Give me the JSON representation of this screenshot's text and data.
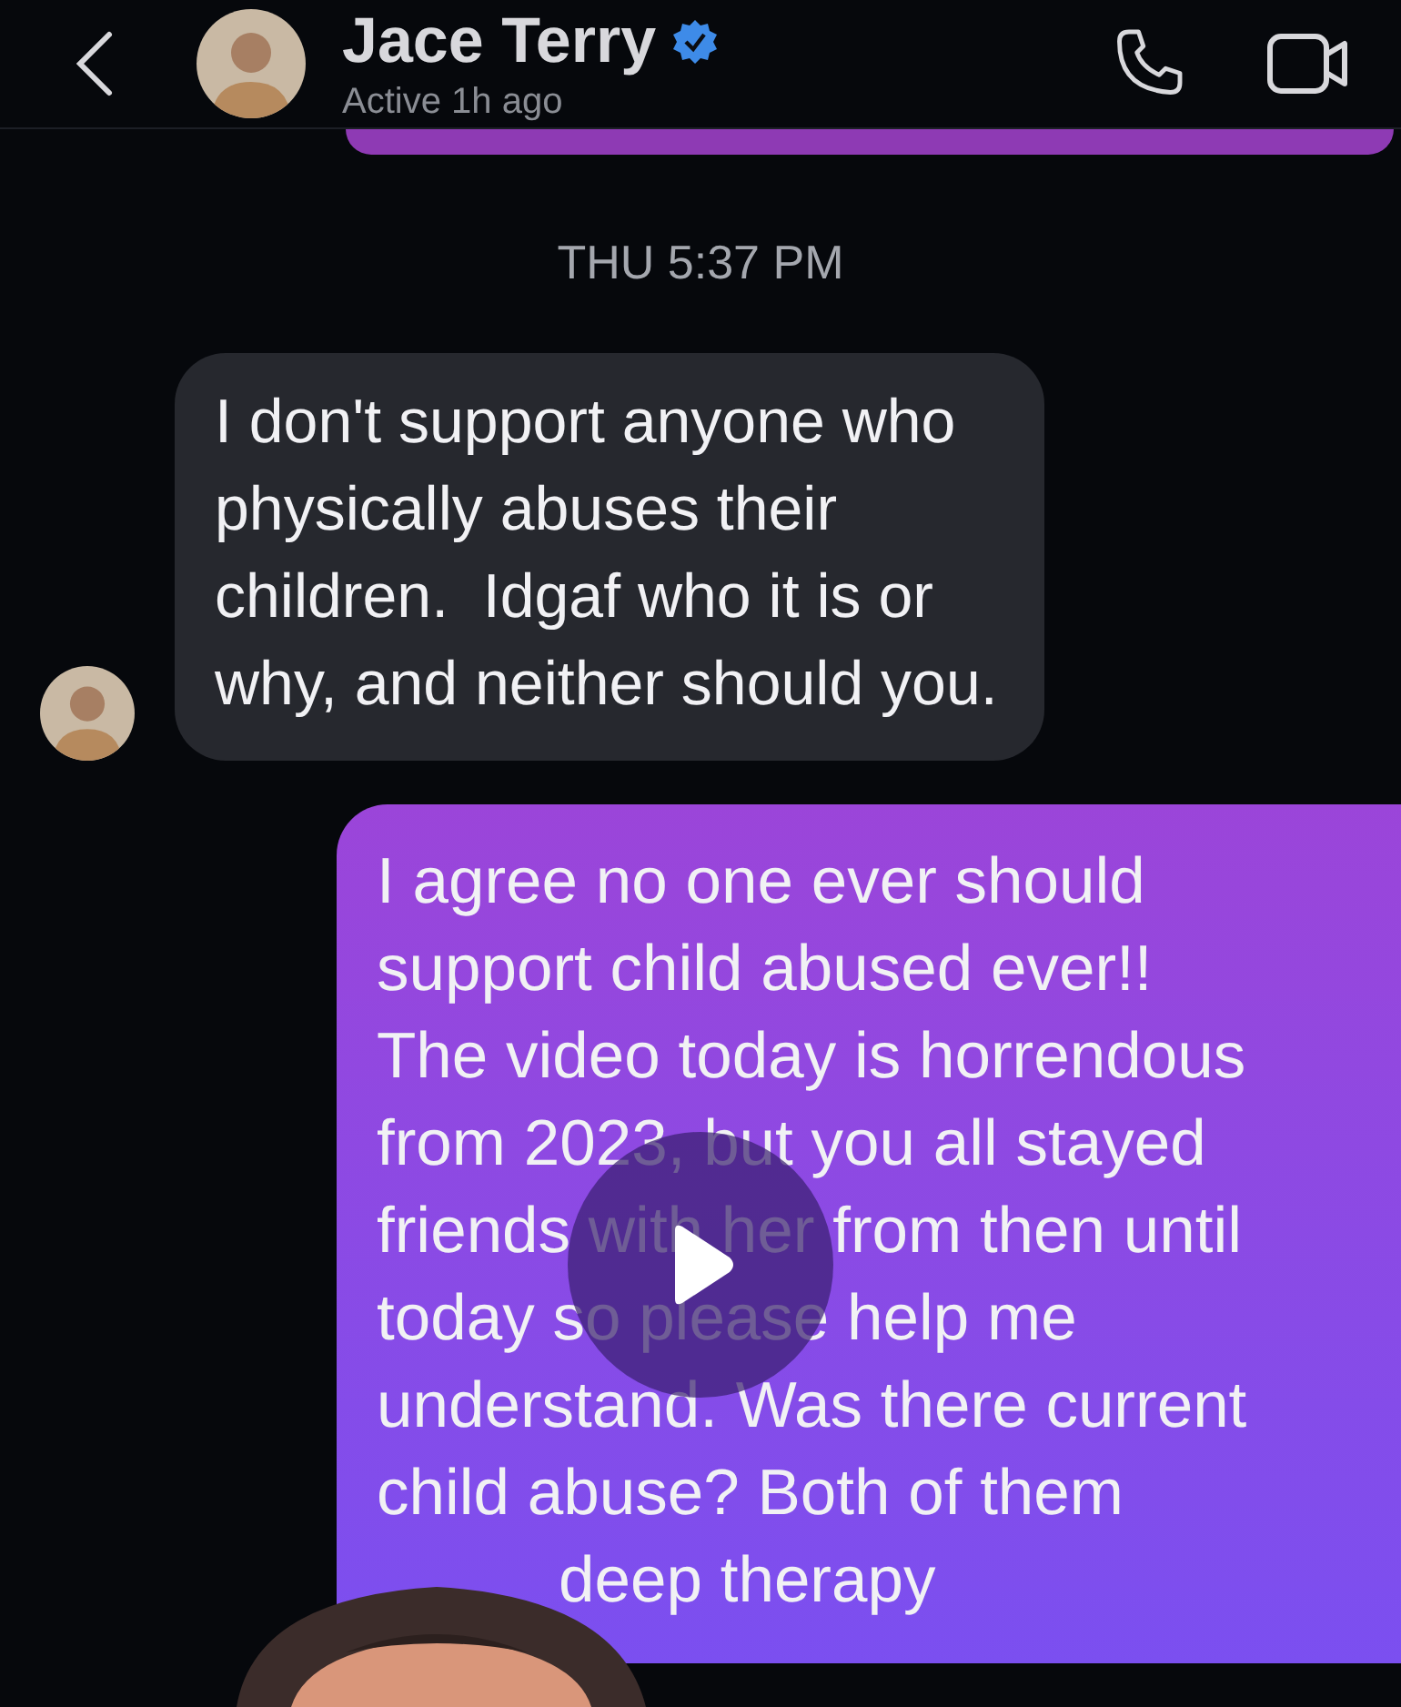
{
  "header": {
    "title": "Jace Terry",
    "verified": true,
    "status": "Active 1h ago"
  },
  "timestamp": "THU 5:37 PM",
  "messages": [
    {
      "kind": "received",
      "lines": [
        "I don't support anyone who",
        "physically abuses their",
        "children.  Idgaf who it is or",
        "why, and neither should you."
      ]
    },
    {
      "kind": "sent",
      "lines": [
        "I agree no one ever should",
        "support child abused ever!!",
        "The video today is horrendous",
        "from 2023, but you all stayed",
        "friends with her from then until",
        "today so please help me",
        "understand. Was there current",
        "child abuse? Both of them",
        "deep therapy"
      ]
    }
  ]
}
